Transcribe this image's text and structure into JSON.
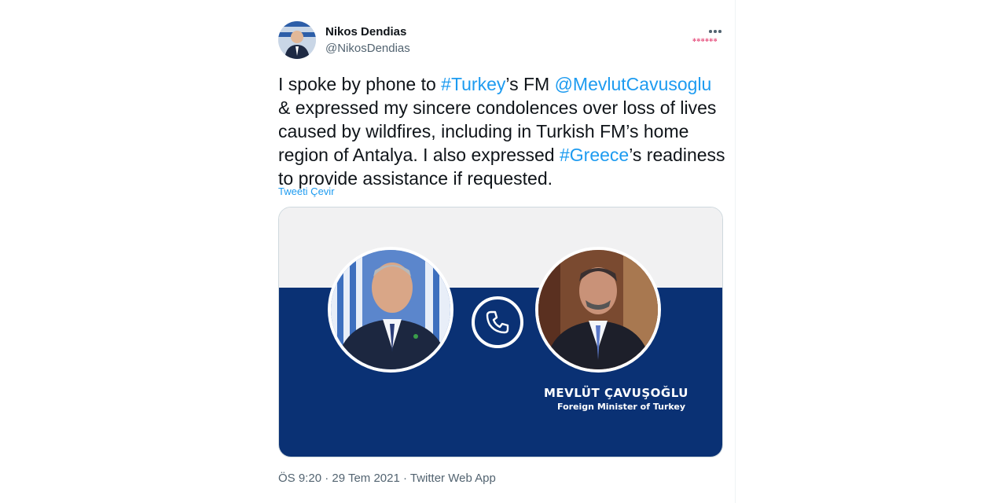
{
  "author": {
    "name": "Nikos Dendias",
    "handle": "@NikosDendias"
  },
  "tweet": {
    "segments": [
      {
        "text": "I spoke by phone to ",
        "type": "text"
      },
      {
        "text": "#Turkey",
        "type": "link"
      },
      {
        "text": "’s FM ",
        "type": "text"
      },
      {
        "text": "@MevlutCavusoglu",
        "type": "link"
      },
      {
        "text": " & expressed my sincere condolences over loss of lives caused by wildfires, including in Turkish FM’s home region of Antalya. I also expressed ",
        "type": "text"
      },
      {
        "text": "#Greece",
        "type": "link"
      },
      {
        "text": "’s readiness to provide assistance if requested.",
        "type": "text"
      }
    ],
    "translate_label": "Tweeti Çevir"
  },
  "media": {
    "caption_name": "MEVLÜT ÇAVUŞOĞLU",
    "caption_title": "Foreign Minister of Turkey",
    "colors": {
      "navy": "#0a3174",
      "light": "#f1f1f2"
    }
  },
  "meta": {
    "timestamp": "ÖS 9:20 · 29 Tem 2021 · Twitter Web App"
  },
  "icons": {
    "more": "more-dots-icon",
    "phone": "phone-icon"
  },
  "colors": {
    "link": "#1d9bf0",
    "secondary": "#536471",
    "text": "#0f1419"
  }
}
